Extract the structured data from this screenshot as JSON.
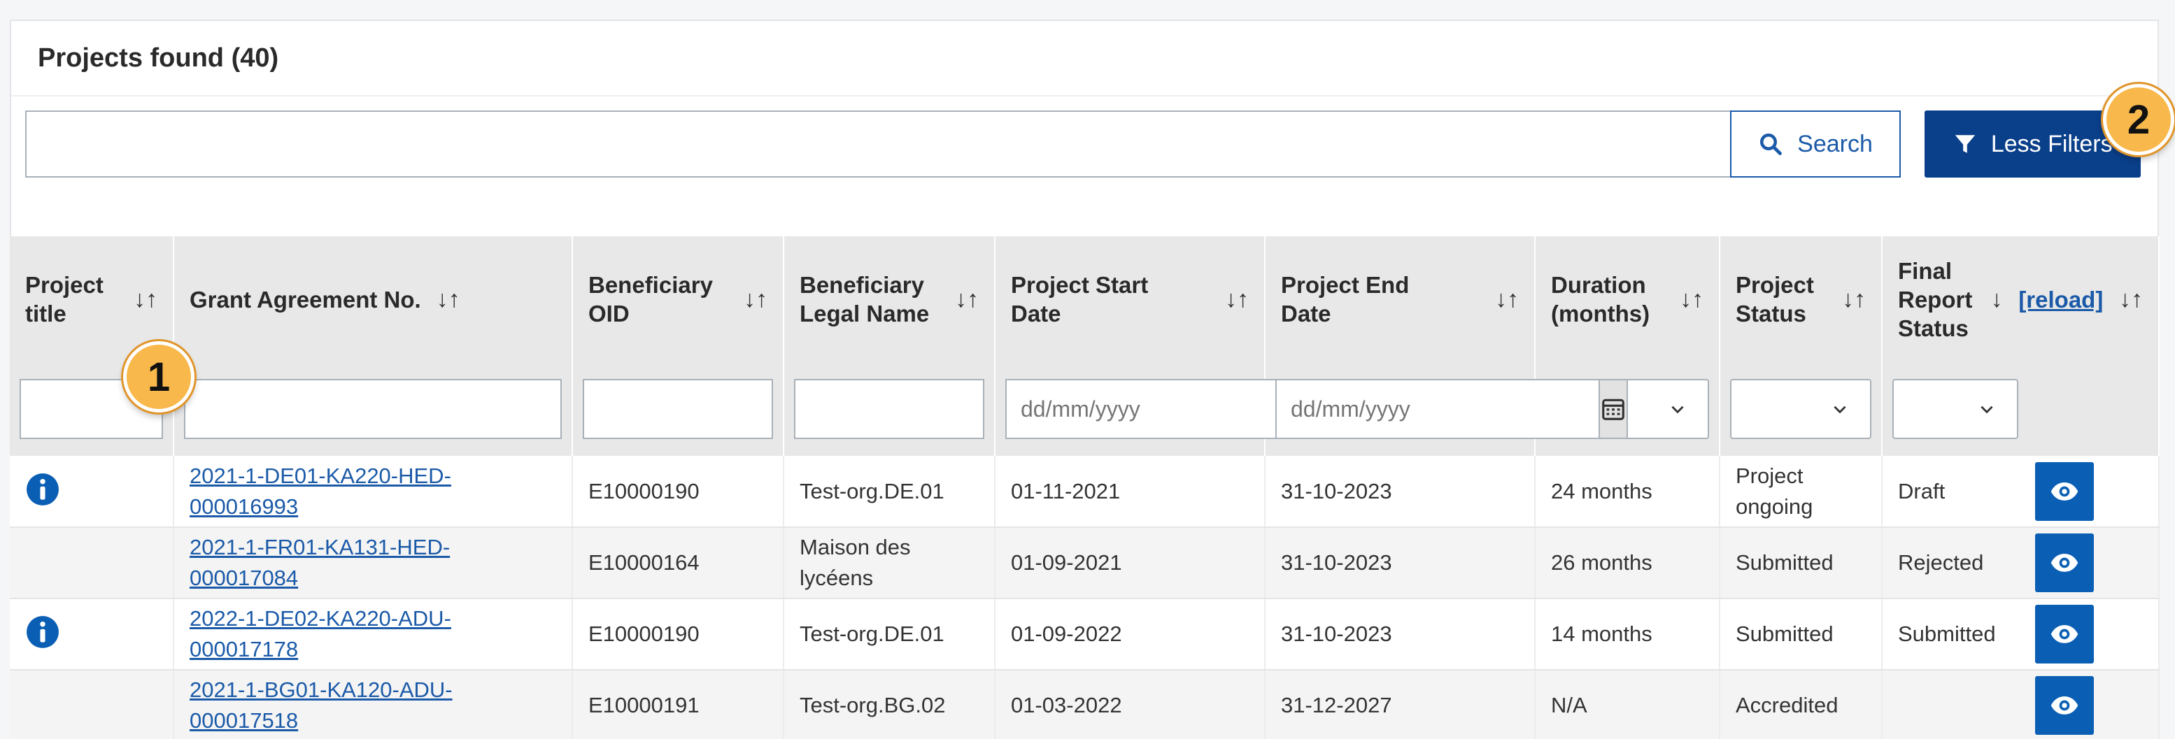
{
  "panel": {
    "title": "Projects found (40)"
  },
  "search": {
    "value": "",
    "button_label": "Search"
  },
  "filters": {
    "button_label": "Less Filters"
  },
  "badges": [
    "1",
    "2"
  ],
  "table": {
    "headers": [
      {
        "label": "Project title"
      },
      {
        "label": "Grant Agreement No."
      },
      {
        "label": "Beneficiary OID"
      },
      {
        "label": "Beneficiary Legal Name"
      },
      {
        "label": "Project Start Date"
      },
      {
        "label": "Project End Date"
      },
      {
        "label": "Duration (months)"
      },
      {
        "label": "Project Status"
      },
      {
        "label": "Final Report Status",
        "reload": "[reload]"
      }
    ],
    "date_placeholder": "dd/mm/yyyy",
    "rows": [
      {
        "info": true,
        "grant": "2021-1-DE01-KA220-HED-000016993",
        "oid": "E10000190",
        "name": "Test-org.DE.01",
        "start": "01-11-2021",
        "end": "31-10-2023",
        "duration": "24 months",
        "status": "Project ongoing",
        "report": "Draft"
      },
      {
        "info": false,
        "grant": "2021-1-FR01-KA131-HED-000017084",
        "oid": "E10000164",
        "name": "Maison des lycéens",
        "start": "01-09-2021",
        "end": "31-10-2023",
        "duration": "26 months",
        "status": "Submitted",
        "report": "Rejected"
      },
      {
        "info": true,
        "grant": "2022-1-DE02-KA220-ADU-000017178",
        "oid": "E10000190",
        "name": "Test-org.DE.01",
        "start": "01-09-2022",
        "end": "31-10-2023",
        "duration": "14 months",
        "status": "Submitted",
        "report": "Submitted"
      },
      {
        "info": false,
        "grant": "2021-1-BG01-KA120-ADU-000017518",
        "oid": "E10000191",
        "name": "Test-org.BG.02",
        "start": "01-03-2022",
        "end": "31-12-2027",
        "duration": "N/A",
        "status": "Accredited",
        "report": ""
      }
    ]
  },
  "colors": {
    "primary": "#0a3f8a",
    "link": "#1b5aa8",
    "badge": "#f8b84b",
    "header_bg": "#e8e8e8"
  },
  "icons": {
    "search": "search-icon",
    "filter": "filter-icon",
    "calendar": "calendar-icon",
    "chevron": "chevron-down-icon",
    "info": "info-icon",
    "view": "eye-icon"
  }
}
